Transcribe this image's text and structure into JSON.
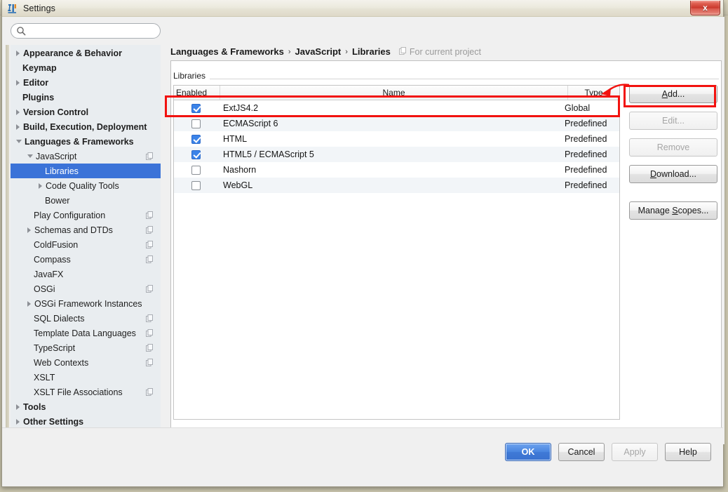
{
  "window": {
    "title": "Settings",
    "app_icon": "idea-icon",
    "close_label": "x"
  },
  "background_tabs": [
    {
      "name": "blurred-tab-1"
    },
    {
      "name": "blurred-tab-2"
    }
  ],
  "search": {
    "value": "",
    "placeholder": "",
    "icon": "search-icon"
  },
  "sidebar": {
    "items": [
      {
        "label": "Appearance & Behavior",
        "indent": 0,
        "twist": "collapsed",
        "bold": true,
        "selected": false,
        "copy": false
      },
      {
        "label": "Keymap",
        "indent": 0,
        "twist": "none",
        "bold": true,
        "selected": false,
        "copy": false
      },
      {
        "label": "Editor",
        "indent": 0,
        "twist": "collapsed",
        "bold": true,
        "selected": false,
        "copy": false
      },
      {
        "label": "Plugins",
        "indent": 0,
        "twist": "none",
        "bold": true,
        "selected": false,
        "copy": false
      },
      {
        "label": "Version Control",
        "indent": 0,
        "twist": "collapsed",
        "bold": true,
        "selected": false,
        "copy": false
      },
      {
        "label": "Build, Execution, Deployment",
        "indent": 0,
        "twist": "collapsed",
        "bold": true,
        "selected": false,
        "copy": false
      },
      {
        "label": "Languages & Frameworks",
        "indent": 0,
        "twist": "expanded",
        "bold": true,
        "selected": false,
        "copy": false
      },
      {
        "label": "JavaScript",
        "indent": 1,
        "twist": "expanded",
        "bold": false,
        "selected": false,
        "copy": true
      },
      {
        "label": "Libraries",
        "indent": 2,
        "twist": "none",
        "bold": false,
        "selected": true,
        "copy": false
      },
      {
        "label": "Code Quality Tools",
        "indent": 2,
        "twist": "collapsed",
        "bold": false,
        "selected": false,
        "copy": false
      },
      {
        "label": "Bower",
        "indent": 2,
        "twist": "none",
        "bold": false,
        "selected": false,
        "copy": false
      },
      {
        "label": "Play Configuration",
        "indent": 1,
        "twist": "none",
        "bold": false,
        "selected": false,
        "copy": true
      },
      {
        "label": "Schemas and DTDs",
        "indent": 1,
        "twist": "collapsed",
        "bold": false,
        "selected": false,
        "copy": true
      },
      {
        "label": "ColdFusion",
        "indent": 1,
        "twist": "none",
        "bold": false,
        "selected": false,
        "copy": true
      },
      {
        "label": "Compass",
        "indent": 1,
        "twist": "none",
        "bold": false,
        "selected": false,
        "copy": true
      },
      {
        "label": "JavaFX",
        "indent": 1,
        "twist": "none",
        "bold": false,
        "selected": false,
        "copy": false
      },
      {
        "label": "OSGi",
        "indent": 1,
        "twist": "none",
        "bold": false,
        "selected": false,
        "copy": true
      },
      {
        "label": "OSGi Framework Instances",
        "indent": 1,
        "twist": "collapsed",
        "bold": false,
        "selected": false,
        "copy": false
      },
      {
        "label": "SQL Dialects",
        "indent": 1,
        "twist": "none",
        "bold": false,
        "selected": false,
        "copy": true
      },
      {
        "label": "Template Data Languages",
        "indent": 1,
        "twist": "none",
        "bold": false,
        "selected": false,
        "copy": true
      },
      {
        "label": "TypeScript",
        "indent": 1,
        "twist": "none",
        "bold": false,
        "selected": false,
        "copy": true
      },
      {
        "label": "Web Contexts",
        "indent": 1,
        "twist": "none",
        "bold": false,
        "selected": false,
        "copy": true
      },
      {
        "label": "XSLT",
        "indent": 1,
        "twist": "none",
        "bold": false,
        "selected": false,
        "copy": false
      },
      {
        "label": "XSLT File Associations",
        "indent": 1,
        "twist": "none",
        "bold": false,
        "selected": false,
        "copy": true
      },
      {
        "label": "Tools",
        "indent": 0,
        "twist": "collapsed",
        "bold": true,
        "selected": false,
        "copy": false
      },
      {
        "label": "Other Settings",
        "indent": 0,
        "twist": "collapsed",
        "bold": true,
        "selected": false,
        "copy": false
      }
    ]
  },
  "breadcrumb": {
    "parts": [
      "Languages & Frameworks",
      "JavaScript",
      "Libraries"
    ],
    "separator": "›",
    "note": "For current project",
    "note_icon": "project-scope-icon"
  },
  "main": {
    "section_label": "Libraries",
    "table": {
      "columns": [
        "Enabled",
        "Name",
        "Type"
      ],
      "rows": [
        {
          "enabled": true,
          "name": "ExtJS4.2",
          "type": "Global"
        },
        {
          "enabled": false,
          "name": "ECMAScript 6",
          "type": "Predefined"
        },
        {
          "enabled": true,
          "name": "HTML",
          "type": "Predefined"
        },
        {
          "enabled": true,
          "name": "HTML5 / ECMAScript 5",
          "type": "Predefined"
        },
        {
          "enabled": false,
          "name": "Nashorn",
          "type": "Predefined"
        },
        {
          "enabled": false,
          "name": "WebGL",
          "type": "Predefined"
        }
      ]
    },
    "side_buttons": [
      {
        "label": "Add...",
        "mnemonic": "A",
        "enabled": true,
        "highlighted": true
      },
      {
        "label": "Edit...",
        "mnemonic": "E",
        "enabled": false,
        "highlighted": false
      },
      {
        "label": "Remove",
        "mnemonic": "R",
        "enabled": false,
        "highlighted": false
      },
      {
        "label": "Download...",
        "mnemonic": "D",
        "enabled": true,
        "highlighted": false
      },
      {
        "label": "Manage Scopes...",
        "mnemonic": "S",
        "enabled": true,
        "highlighted": false
      }
    ]
  },
  "footer": {
    "buttons": [
      {
        "label": "OK",
        "style": "primary",
        "enabled": true
      },
      {
        "label": "Cancel",
        "style": "normal",
        "enabled": true
      },
      {
        "label": "Apply",
        "style": "disabled",
        "enabled": false
      },
      {
        "label": "Help",
        "style": "normal",
        "enabled": true
      }
    ]
  },
  "annotations": {
    "accent_color": "#f2120f",
    "shapes": [
      {
        "name": "highlight-row-extjs",
        "type": "rect"
      },
      {
        "name": "highlight-add-button",
        "type": "rect"
      },
      {
        "name": "pointer-arrow",
        "type": "arrow"
      }
    ]
  }
}
